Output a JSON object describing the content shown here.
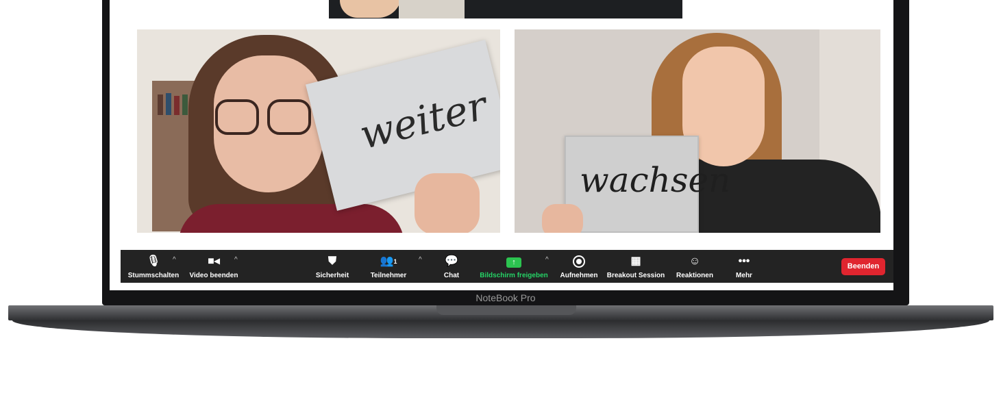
{
  "meeting": {
    "participants": [
      {
        "sign_text": "weiter"
      },
      {
        "sign_text": "wachsen"
      }
    ]
  },
  "toolbar": {
    "mute_label": "Stummschalten",
    "video_label": "Video beenden",
    "security_label": "Sicherheit",
    "participants_label": "Teilnehmer",
    "participants_count": "1",
    "chat_label": "Chat",
    "share_label": "Bildschirm freigeben",
    "record_label": "Aufnehmen",
    "breakout_label": "Breakout Session",
    "reactions_label": "Reaktionen",
    "more_label": "Mehr",
    "end_label": "Beenden"
  },
  "laptop": {
    "brand_label": "NoteBook Pro"
  },
  "icons": {
    "mute": "microphone-icon",
    "video": "video-camera-icon",
    "security": "shield-icon",
    "participants": "people-icon",
    "chat": "chat-bubble-icon",
    "share": "share-screen-icon",
    "record": "record-icon",
    "breakout": "grid-icon",
    "reactions": "smiley-icon",
    "more": "ellipsis-icon"
  },
  "colors": {
    "toolbar_bg": "#232323",
    "share_active": "#25d366",
    "end_button": "#e0252f"
  }
}
